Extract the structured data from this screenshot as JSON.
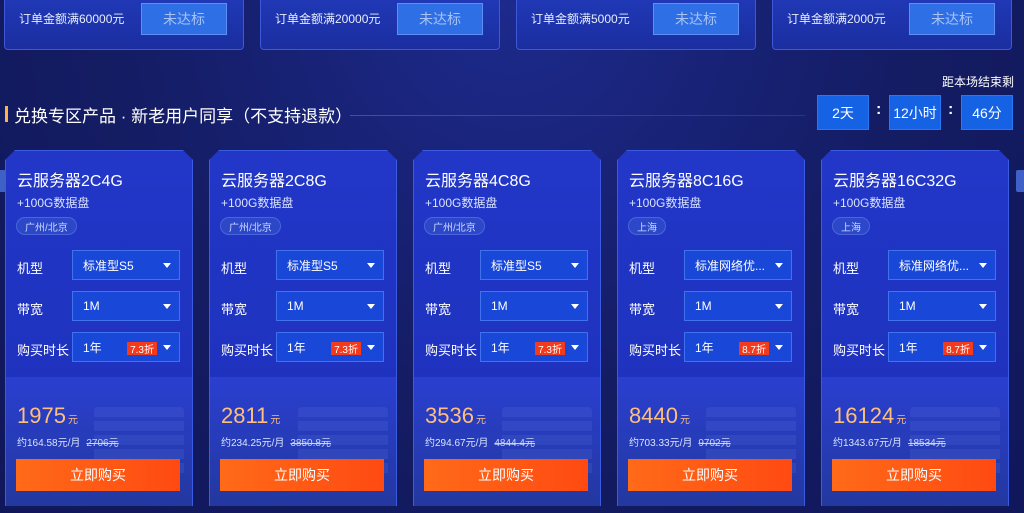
{
  "tiers": [
    {
      "text": "订单金额满60000元",
      "button": "未达标"
    },
    {
      "text": "订单金额满20000元",
      "button": "未达标"
    },
    {
      "text": "订单金额满5000元",
      "button": "未达标"
    },
    {
      "text": "订单金额满2000元",
      "button": "未达标"
    }
  ],
  "section": {
    "title": "兑换专区产品 · 新老用户同享（不支持退款）",
    "countdown_label": "距本场结束剩",
    "countdown": {
      "days": "2天",
      "hours": "12小时",
      "minutes": "46分",
      "sep": ":"
    }
  },
  "labels": {
    "model": "机型",
    "bandwidth": "带宽",
    "duration": "购买时长",
    "buy": "立即购买",
    "price_unit": "元"
  },
  "products": [
    {
      "name": "云服务器2C4G",
      "disk": "+100G数据盘",
      "region": "广州/北京",
      "model": "标准型S5",
      "bandwidth": "1M",
      "duration": "1年",
      "discount": "7.3折",
      "price": "1975",
      "monthly": "约164.58元/月",
      "original": "2706元"
    },
    {
      "name": "云服务器2C8G",
      "disk": "+100G数据盘",
      "region": "广州/北京",
      "model": "标准型S5",
      "bandwidth": "1M",
      "duration": "1年",
      "discount": "7.3折",
      "price": "2811",
      "monthly": "约234.25元/月",
      "original": "3850.8元"
    },
    {
      "name": "云服务器4C8G",
      "disk": "+100G数据盘",
      "region": "广州/北京",
      "model": "标准型S5",
      "bandwidth": "1M",
      "duration": "1年",
      "discount": "7.3折",
      "price": "3536",
      "monthly": "约294.67元/月",
      "original": "4844.4元"
    },
    {
      "name": "云服务器8C16G",
      "disk": "+100G数据盘",
      "region": "上海",
      "model": "标准网络优...",
      "bandwidth": "1M",
      "duration": "1年",
      "discount": "8.7折",
      "price": "8440",
      "monthly": "约703.33元/月",
      "original": "9702元"
    },
    {
      "name": "云服务器16C32G",
      "disk": "+100G数据盘",
      "region": "上海",
      "model": "标准网络优...",
      "bandwidth": "1M",
      "duration": "1年",
      "discount": "8.7折",
      "price": "16124",
      "monthly": "约1343.67元/月",
      "original": "18534元"
    }
  ]
}
